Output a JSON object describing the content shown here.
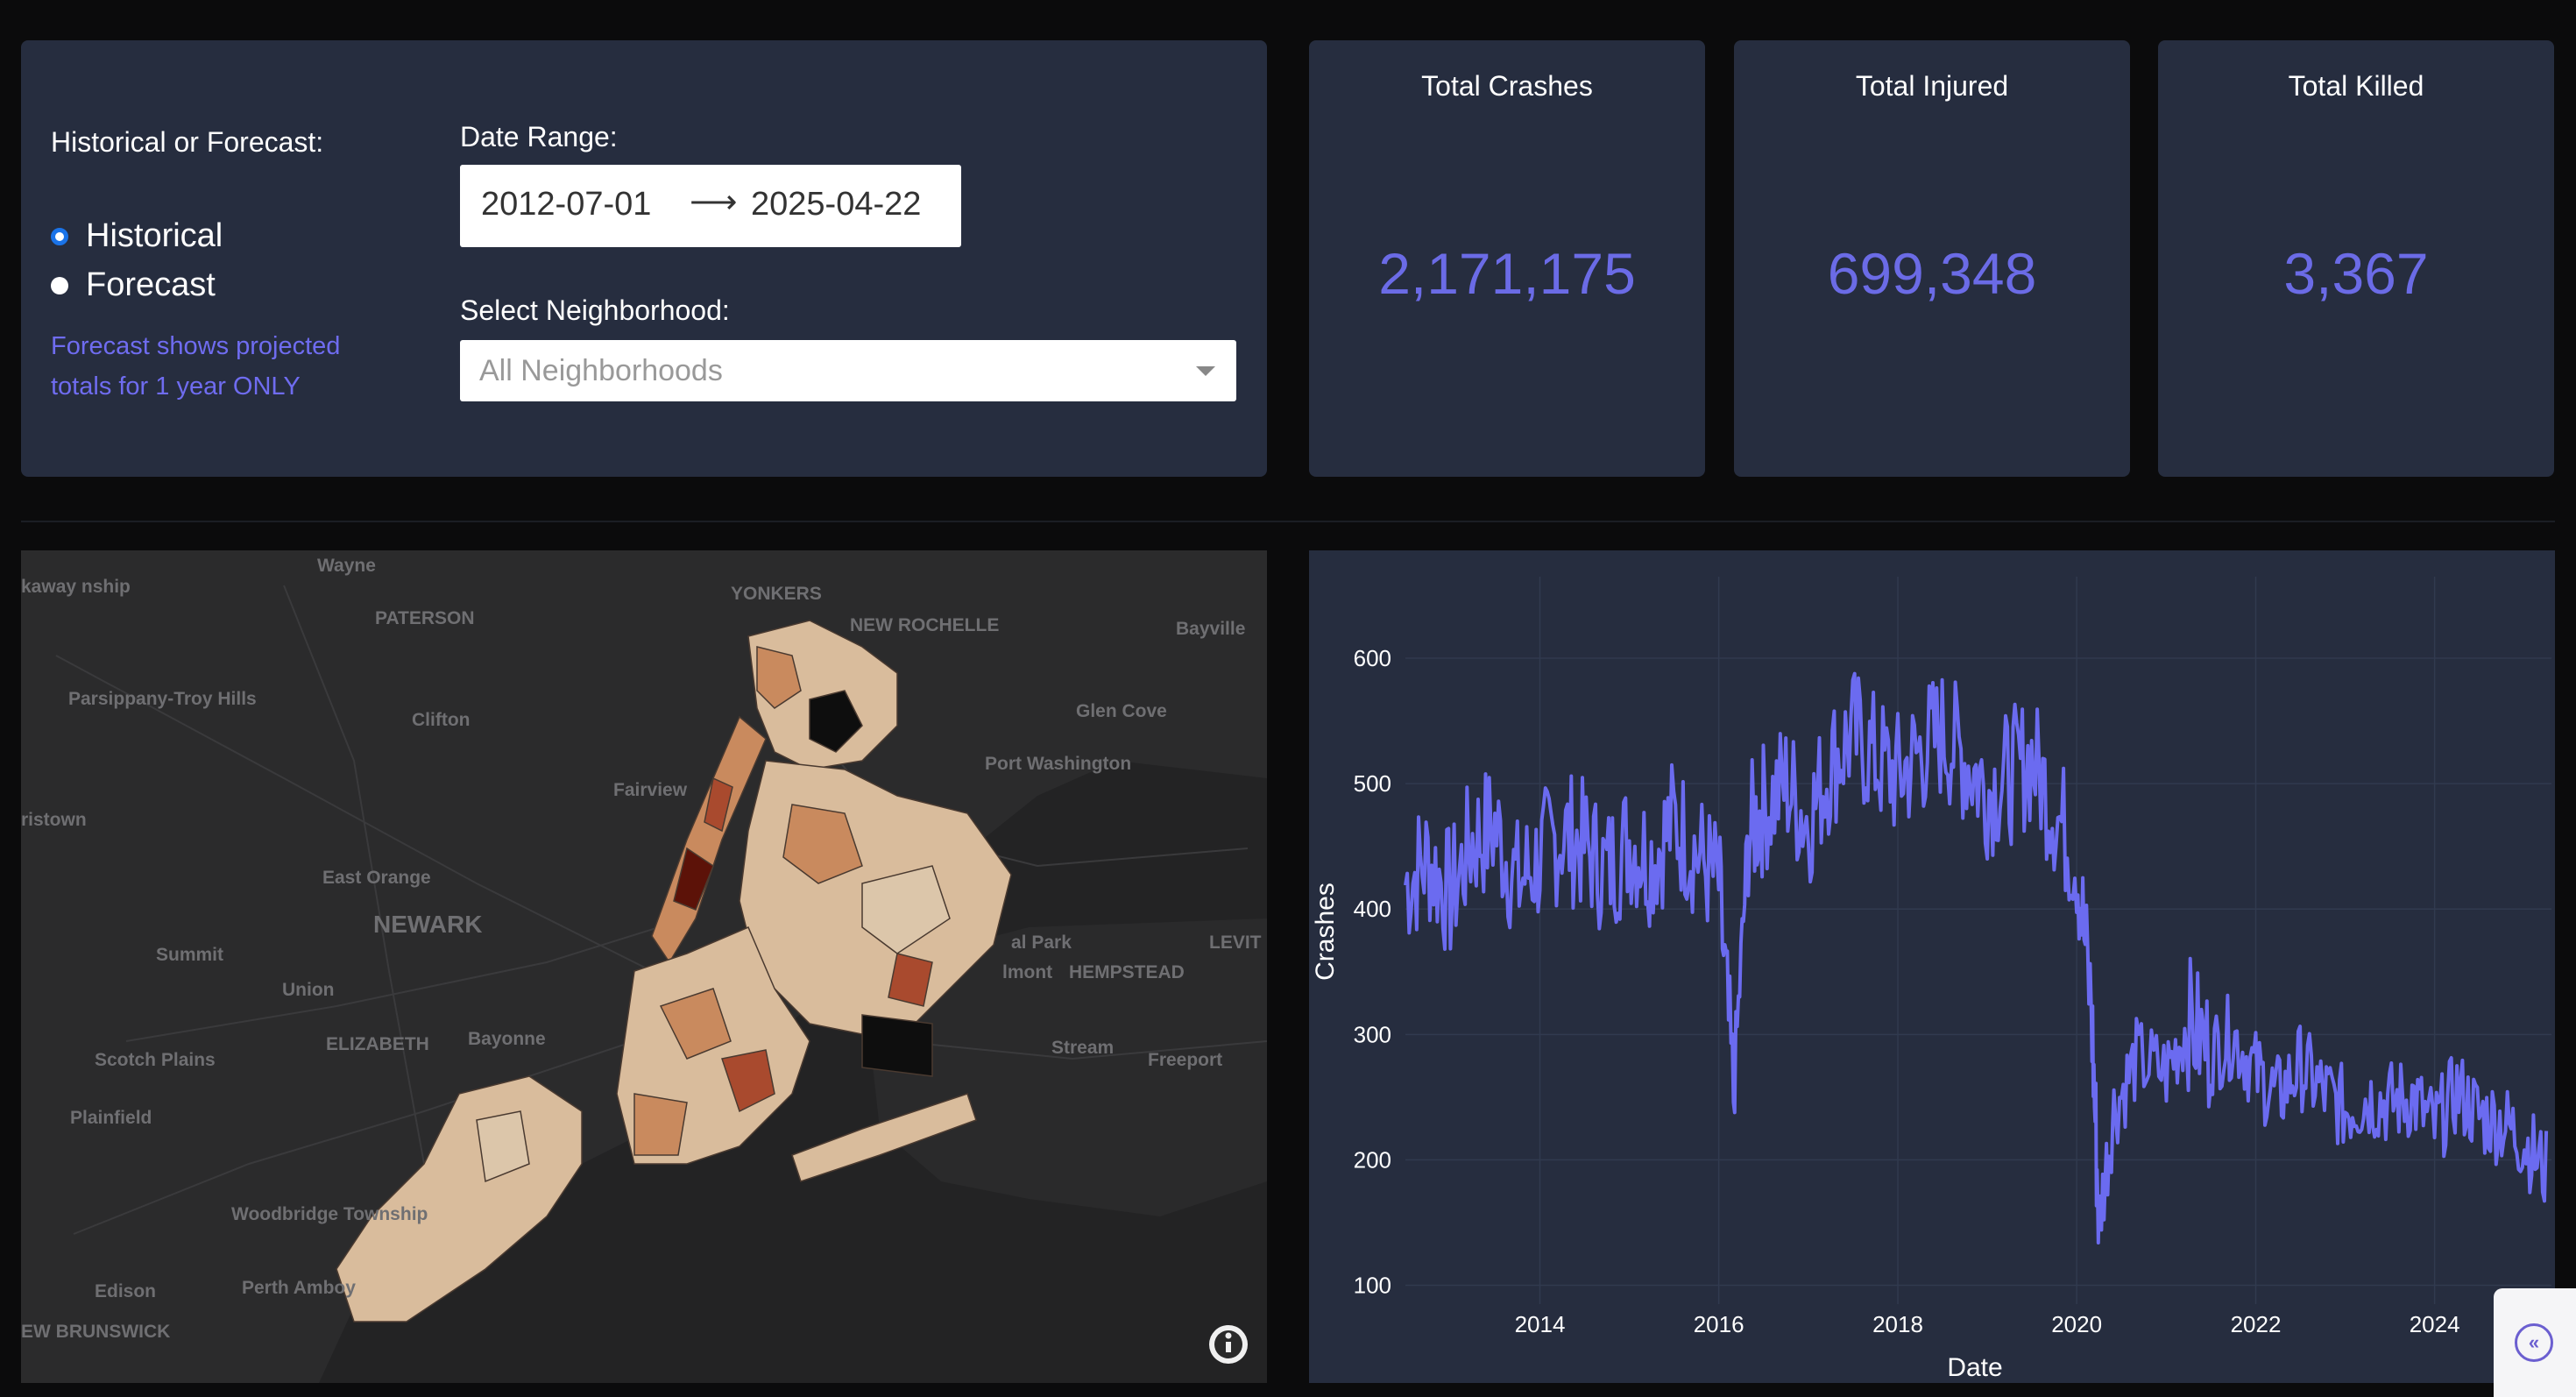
{
  "controls": {
    "mode_label": "Historical or Forecast:",
    "options": [
      {
        "label": "Historical",
        "checked": true
      },
      {
        "label": "Forecast",
        "checked": false
      }
    ],
    "note_line1": "Forecast shows projected",
    "note_line2": "totals for 1 year ONLY",
    "date_label": "Date Range:",
    "date_start": "2012-07-01",
    "date_arrow": "⟶",
    "date_end": "2025-04-22",
    "hood_label": "Select Neighborhood:",
    "hood_placeholder": "All Neighborhoods"
  },
  "kpis": {
    "crashes": {
      "title": "Total Crashes",
      "value": "2,171,175"
    },
    "injured": {
      "title": "Total Injured",
      "value": "699,348"
    },
    "killed": {
      "title": "Total Killed",
      "value": "3,367"
    }
  },
  "map": {
    "place_labels": [
      "Wayne",
      "PATERSON",
      "YONKERS",
      "NEW ROCHELLE",
      "Bayville",
      "Parsippany-Troy Hills",
      "Clifton",
      "Glen Cove",
      "Port Washington",
      "Fairview",
      "East Orange",
      "NEWARK",
      "Summit",
      "Union",
      "ELIZABETH",
      "Bayonne",
      "Scotch Plains",
      "Plainfield",
      "Woodbridge Township",
      "Edison",
      "Perth Amboy",
      "EW BRUNSWICK",
      "HEMPSTEAD",
      "LEVIT",
      "Freeport",
      "Stream",
      "al Park",
      "lmont",
      "kaway nship",
      "ristown"
    ],
    "info_icon": "info-icon",
    "colors": {
      "light": "#d9bc9c",
      "mid": "#c98a5e",
      "dark": "#a94a2e",
      "darkest": "#5c1208",
      "water": "#1f1f20",
      "land": "#2a2a2a"
    }
  },
  "chart_data": {
    "type": "line",
    "xlabel": "Date",
    "ylabel": "Crashes",
    "x_ticks": [
      "2014",
      "2016",
      "2018",
      "2020",
      "2022",
      "2024"
    ],
    "y_ticks": [
      "100",
      "200",
      "300",
      "400",
      "500",
      "600"
    ],
    "xlim": [
      "2012-07-01",
      "2025-04-22"
    ],
    "ylim": [
      85,
      665
    ],
    "line_color": "#6b6bf0",
    "series": [
      {
        "x": [
          "2012-07",
          "2012-10",
          "2013-01",
          "2013-04",
          "2013-07",
          "2013-10",
          "2014-01",
          "2014-04",
          "2014-07",
          "2014-10",
          "2015-01",
          "2015-04",
          "2015-07",
          "2015-10",
          "2016-01",
          "2016-03",
          "2016-05",
          "2016-07",
          "2016-10",
          "2017-01",
          "2017-04",
          "2017-07",
          "2017-10",
          "2018-01",
          "2018-04",
          "2018-07",
          "2018-10",
          "2019-01",
          "2019-04",
          "2019-07",
          "2019-10",
          "2020-01",
          "2020-03",
          "2020-04",
          "2020-06",
          "2020-09",
          "2021-01",
          "2021-04",
          "2021-07",
          "2021-10",
          "2022-01",
          "2022-04",
          "2022-07",
          "2022-10",
          "2023-01",
          "2023-04",
          "2023-07",
          "2023-10",
          "2024-01",
          "2024-04",
          "2024-07",
          "2024-10",
          "2025-01",
          "2025-04"
        ],
        "y": [
          420,
          440,
          410,
          455,
          465,
          420,
          440,
          460,
          450,
          430,
          455,
          440,
          470,
          445,
          420,
          250,
          460,
          480,
          500,
          470,
          515,
          540,
          520,
          505,
          525,
          540,
          520,
          495,
          505,
          520,
          480,
          440,
          320,
          150,
          240,
          280,
          270,
          310,
          285,
          300,
          270,
          250,
          275,
          255,
          240,
          250,
          245,
          250,
          225,
          255,
          235,
          230,
          215,
          190
        ]
      }
    ]
  }
}
